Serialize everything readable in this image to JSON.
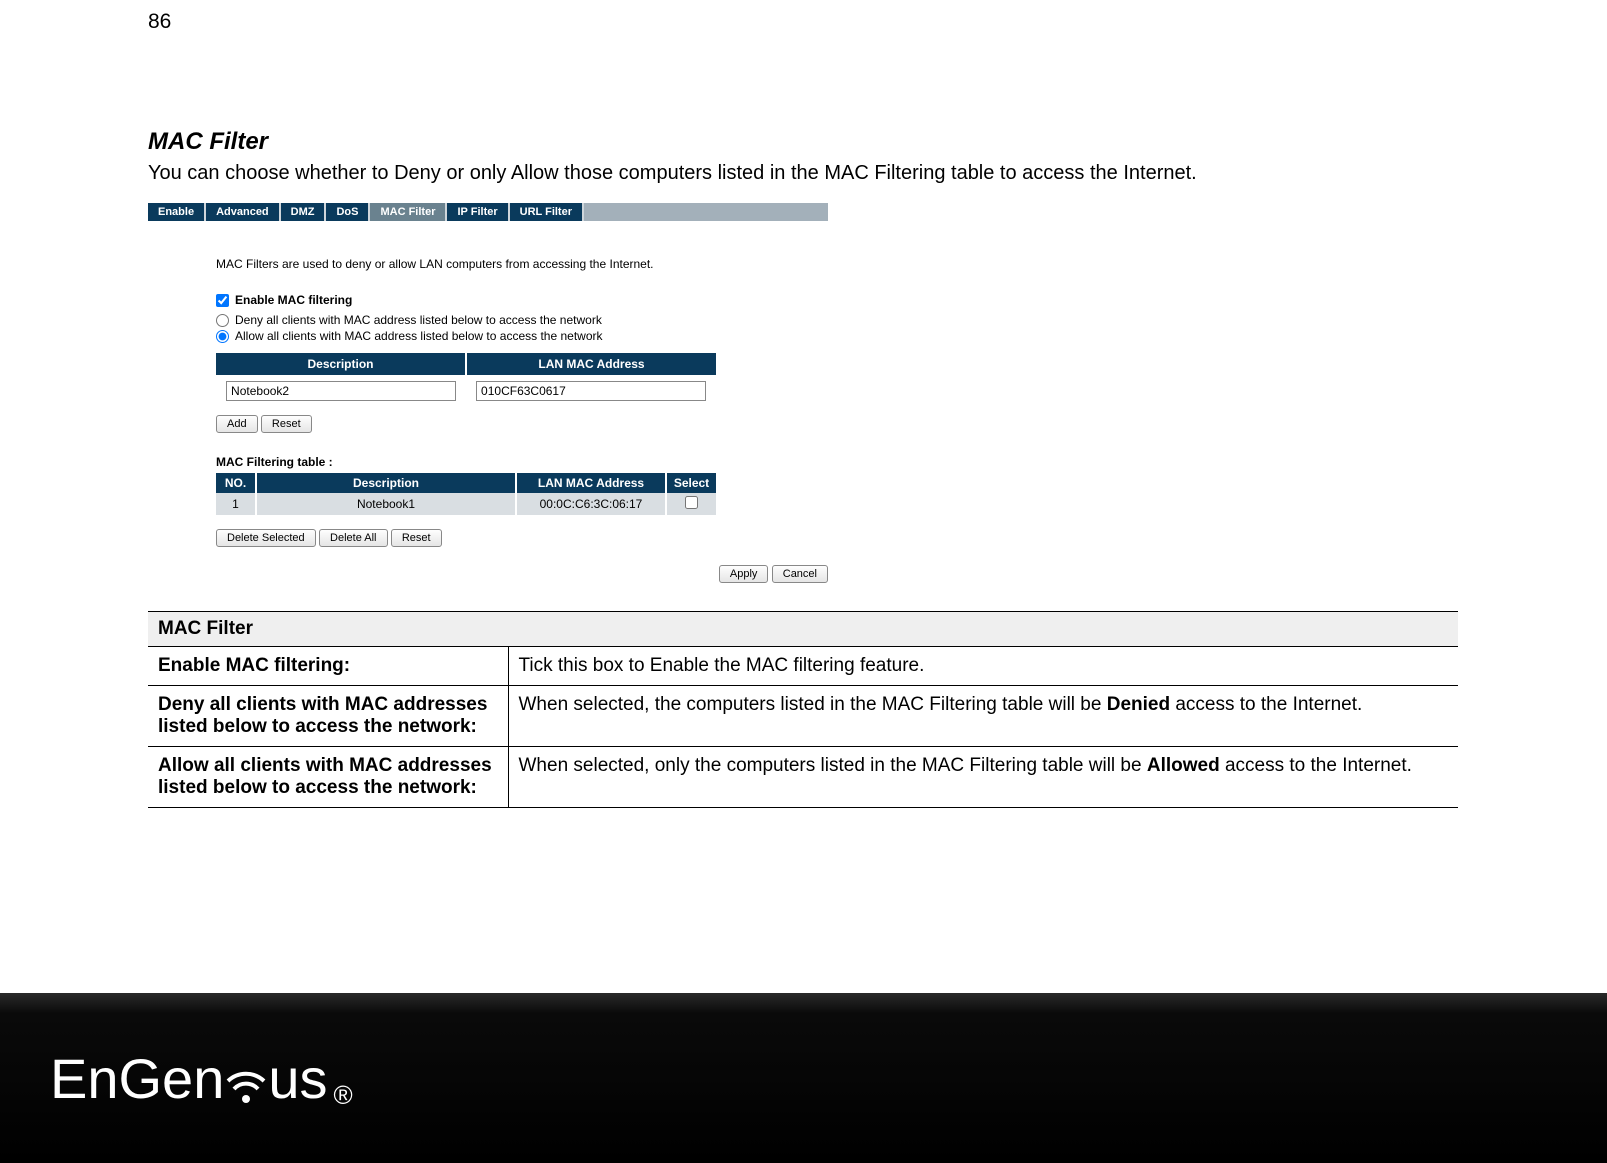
{
  "page_number": "86",
  "section": {
    "title": "MAC Filter",
    "description": "You can choose whether to Deny or only Allow those computers listed in the MAC Filtering table to access the Internet."
  },
  "screenshot": {
    "tabs": [
      "Enable",
      "Advanced",
      "DMZ",
      "DoS",
      "MAC Filter",
      "IP Filter",
      "URL Filter"
    ],
    "active_tab_index": 4,
    "note": "MAC Filters are used to deny or allow LAN computers from accessing the Internet.",
    "enable_label": "Enable MAC filtering",
    "radio_deny": "Deny all clients with MAC address listed below to access the network",
    "radio_allow": "Allow all clients with MAC address listed below to access the network",
    "input_headers": {
      "desc": "Description",
      "mac": "LAN MAC Address"
    },
    "input_values": {
      "desc": "Notebook2",
      "mac": "010CF63C0617"
    },
    "add_btn": "Add",
    "reset_btn": "Reset",
    "table_title": "MAC Filtering table :",
    "table_headers": {
      "no": "NO.",
      "desc": "Description",
      "mac": "LAN MAC Address",
      "select": "Select"
    },
    "table_rows": [
      {
        "no": "1",
        "desc": "Notebook1",
        "mac": "00:0C:C6:3C:06:17"
      }
    ],
    "delete_selected_btn": "Delete Selected",
    "delete_all_btn": "Delete All",
    "reset2_btn": "Reset",
    "apply_btn": "Apply",
    "cancel_btn": "Cancel"
  },
  "explain_table": {
    "header": "MAC Filter",
    "rows": [
      {
        "left": "Enable MAC filtering:",
        "right_plain": "Tick this box to Enable the MAC filtering feature."
      },
      {
        "left": "Deny all clients with MAC addresses listed below to access the network:",
        "right_pre": "When selected, the computers listed in the MAC Filtering table will be ",
        "right_bold": "Denied",
        "right_post": " access to the Internet."
      },
      {
        "left": "Allow all clients with MAC addresses listed below to access the network:",
        "right_pre": "When selected, only the computers listed in the MAC Filtering table will be ",
        "right_bold": "Allowed",
        "right_post": " access to the Internet."
      }
    ]
  },
  "footer": {
    "brand_pre": "EnGen",
    "brand_post": "us",
    "reg": "®"
  }
}
